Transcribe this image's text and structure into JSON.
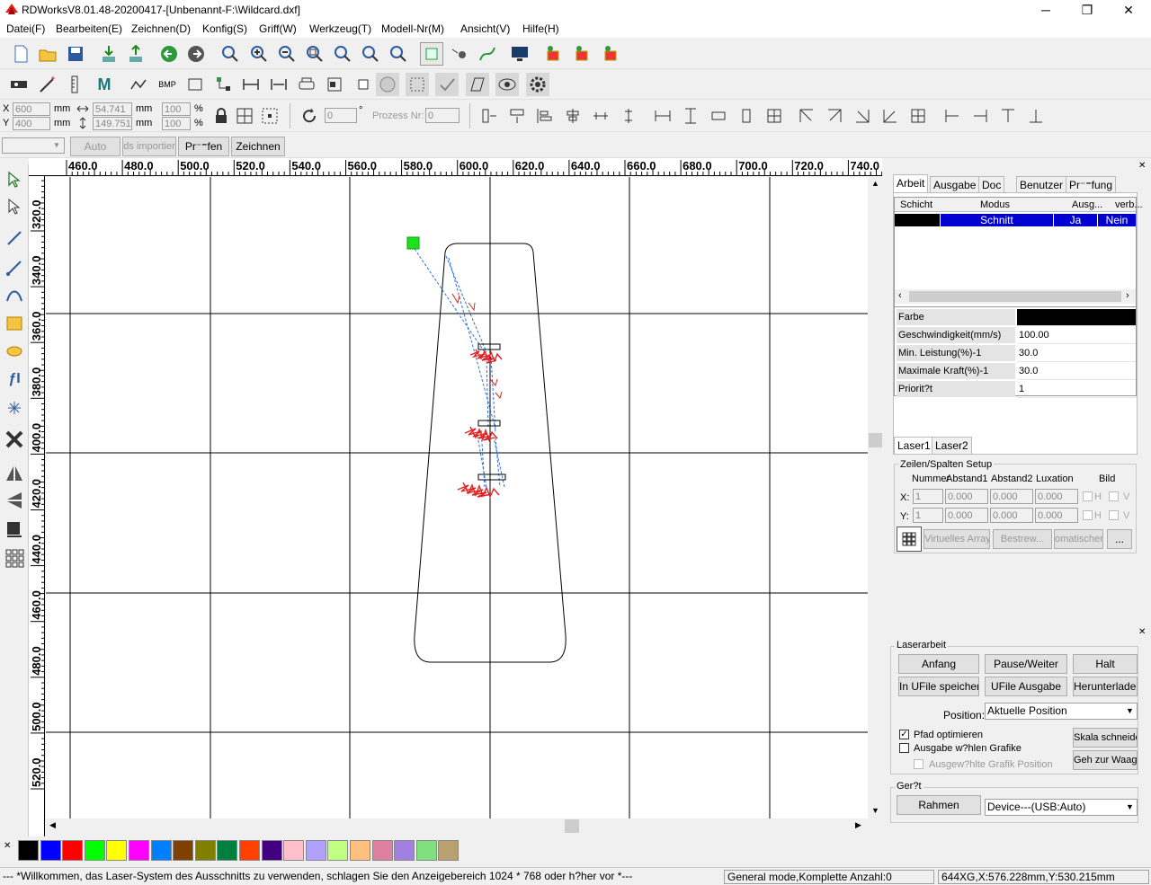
{
  "window": {
    "title": "RDWorksV8.01.48-20200417-[Unbenannt-F:\\Wildcard.dxf]",
    "minimize": "─",
    "maximize": "❐",
    "close": "✕"
  },
  "menu": [
    "Datei(F)",
    "Bearbeiten(E)",
    "Zeichnen(D)",
    "Konfig(S)",
    "Griff(W)",
    "Werkzeug(T)",
    "Modell-Nr(M)",
    "Ansicht(V)",
    "Hilfe(H)"
  ],
  "toolbar3": {
    "x_label": "X",
    "y_label": "Y",
    "x_value": "600",
    "y_value": "400",
    "unit": "mm",
    "width": "54.741",
    "height": "149.751",
    "pct_w": "100",
    "pct_h": "100",
    "pct": "%",
    "rotate": "0",
    "deg": "°",
    "prozess_label": "Prozess Nr:",
    "prozess_value": "0"
  },
  "toolbar4": {
    "layer_combo": "",
    "auto": "Auto",
    "import": "ds importier",
    "pruefen": "Pr⁻⁼fen",
    "zeichnen": "Zeichnen"
  },
  "ruler": {
    "h": [
      "460.0",
      "480.0",
      "500.0",
      "520.0",
      "540.0",
      "560.0",
      "580.0",
      "600.0",
      "620.0",
      "640.0",
      "660.0",
      "680.0",
      "700.0",
      "720.0",
      "740.0"
    ],
    "v": [
      "320.0",
      "340.0",
      "360.0",
      "380.0",
      "400.0",
      "420.0",
      "440.0",
      "460.0",
      "480.0",
      "500.0",
      "520.0"
    ]
  },
  "panel": {
    "tabs": [
      "Arbeit",
      "Ausgabe",
      "Doc",
      "Benutzer",
      "Pr⁻⁼fung"
    ],
    "layer_headers": [
      "Schicht",
      "Modus",
      "Ausg...",
      "verb..."
    ],
    "layer_row": {
      "color": "#000000",
      "mode": "Schnitt",
      "output": "Ja",
      "lock": "Nein"
    },
    "props": [
      {
        "k": "Farbe",
        "v": ""
      },
      {
        "k": "Geschwindigkeit(mm/s)",
        "v": "100.00"
      },
      {
        "k": "Min. Leistung(%)-1",
        "v": "30.0"
      },
      {
        "k": "Maximale Kraft(%)-1",
        "v": "30.0"
      },
      {
        "k": "Priorit?t",
        "v": "1"
      }
    ],
    "laser_tabs": [
      "Laser1",
      "Laser2"
    ],
    "array": {
      "title": "Zeilen/Spalten Setup",
      "headers": [
        "Nummer",
        "Abstand1",
        "Abstand2",
        "Luxation",
        "Bild"
      ],
      "x": "X:",
      "y": "Y:",
      "xnum": "1",
      "ynum": "1",
      "zero": "0.000",
      "h": "H",
      "v": "V",
      "btn_virtual": "Virtuelles Array",
      "btn_bestr": "Bestrew...",
      "btn_auto": "omatischer",
      "btn_more": "..."
    },
    "laserarbeit": {
      "title": "Laserarbeit",
      "start": "Anfang",
      "pause": "Pause/Weiter",
      "stop": "Halt",
      "save_ufile": "In UFile speichern",
      "ufile_out": "UFile Ausgabe",
      "download": "Herunterladen",
      "pos_label": "Position:",
      "pos_value": "Aktuelle Position",
      "opt_path": "Pfad optimieren",
      "sel_out": "Ausgabe w?hlen Grafike",
      "sel_pos": "Ausgew?hlte Grafik Position",
      "scale_cut": "Skala schneider",
      "goto_scale": "Geh zur Waage"
    },
    "geraet": {
      "title": "Ger?t",
      "frame": "Rahmen",
      "device": "Device---(USB:Auto)"
    }
  },
  "palette": [
    "#000000",
    "#0000ff",
    "#ff0000",
    "#00ff00",
    "#ffff00",
    "#ff00ff",
    "#0080ff",
    "#804000",
    "#808000",
    "#008040",
    "#ff4000",
    "#400080",
    "#ffc0cb",
    "#b0a0ff",
    "#c0ff80",
    "#ffc080",
    "#e080a0",
    "#a080e0",
    "#80e080",
    "#b8a070"
  ],
  "status": {
    "msg": "--- *Willkommen, das Laser-System des Ausschnitts zu verwenden, schlagen Sie den Anzeigebereich 1024 * 768 oder h?her vor *---",
    "mode": "General mode,Komplette Anzahl:0",
    "coords": "644XG,X:576.228mm,Y:530.215mm"
  }
}
